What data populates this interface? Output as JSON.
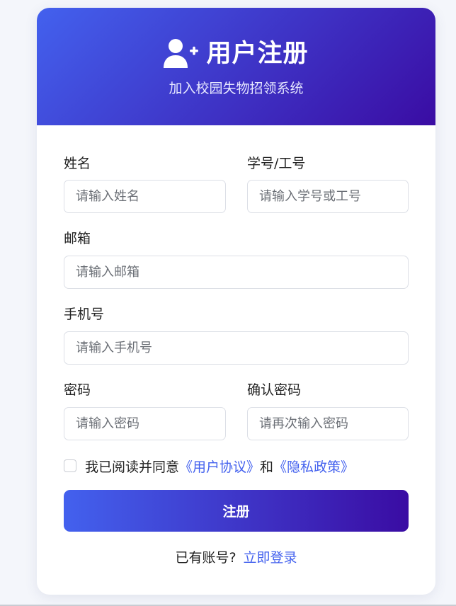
{
  "header": {
    "title": "用户注册",
    "subtitle": "加入校园失物招领系统",
    "icon": "user-plus-icon"
  },
  "form": {
    "name": {
      "label": "姓名",
      "placeholder": "请输入姓名"
    },
    "student_id": {
      "label": "学号/工号",
      "placeholder": "请输入学号或工号"
    },
    "email": {
      "label": "邮箱",
      "placeholder": "请输入邮箱"
    },
    "phone": {
      "label": "手机号",
      "placeholder": "请输入手机号"
    },
    "password": {
      "label": "密码",
      "placeholder": "请输入密码"
    },
    "confirm_password": {
      "label": "确认密码",
      "placeholder": "请再次输入密码"
    },
    "agreement": {
      "prefix": "我已阅读并同意",
      "terms_link": "《用户协议》",
      "and": "和",
      "privacy_link": "《隐私政策》"
    },
    "submit_label": "注册"
  },
  "footer": {
    "has_account": "已有账号?",
    "login_link": "立即登录"
  },
  "colors": {
    "gradient_start": "#4361ee",
    "gradient_end": "#3a0ca3",
    "link": "#4361ee"
  }
}
